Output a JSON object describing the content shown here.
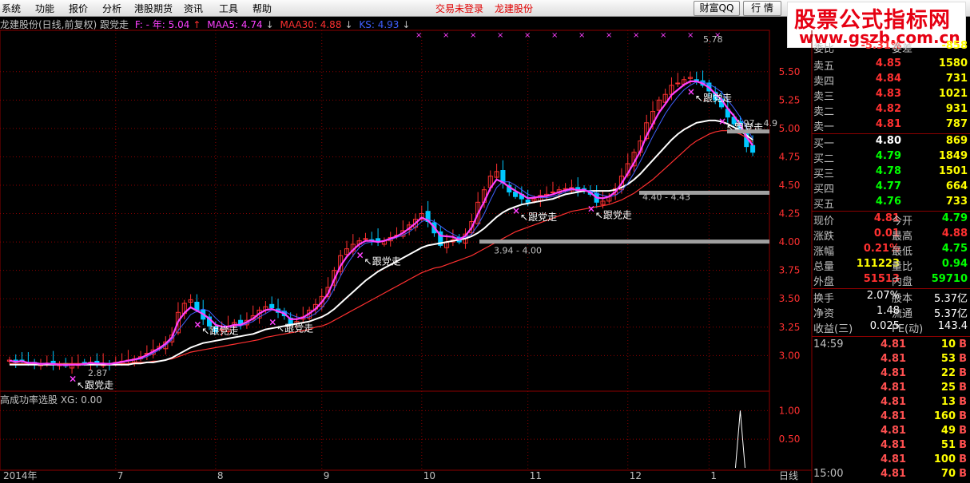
{
  "menu": {
    "items": [
      "系统",
      "功能",
      "报价",
      "分析",
      "港股期货",
      "资讯",
      "工具",
      "帮助"
    ],
    "status": "交易未登录",
    "stock_name": "龙建股份",
    "buttons": [
      "财富QQ",
      "行 情"
    ]
  },
  "watermark": {
    "line1": "股票公式指标网",
    "line2": "www.gszb.com.cn"
  },
  "info": {
    "title": "龙建股份(日线,前复权) 跟党走",
    "f_label": "F: - 年: 5.04",
    "maa5": "MAA5: 4.74",
    "maa30": "MAA30: 4.88",
    "ks": "KS: 4.93",
    "sub_label": "高成功率选股 XG: 0.00"
  },
  "colors": {
    "up": "#ff3030",
    "down": "#00c8ff",
    "maa5": "#ff40ff",
    "maa30": "#ff3030",
    "ks": "#4060ff",
    "white": "#ffffff",
    "grid": "#8b0000"
  },
  "chart_data": {
    "type": "candlestick",
    "x_tick_labels": [
      "2014年",
      "7",
      "8",
      "9",
      "10",
      "11",
      "12",
      "1"
    ],
    "y_ticks": [
      "5.50",
      "5.25",
      "5.00",
      "4.75",
      "4.50",
      "4.25",
      "4.00",
      "3.75",
      "3.50",
      "3.25",
      "3.00"
    ],
    "ylim": [
      2.7,
      5.85
    ],
    "sub_y_ticks": [
      "1.00",
      "0.50"
    ],
    "sub_ylim": [
      0,
      1.2
    ],
    "annotations": [
      "5.78",
      "2.87",
      "3.94 - 4.00",
      "4.40 - 4.43",
      "4.97 - 4.9",
      "跟党走"
    ],
    "closes": [
      2.96,
      2.94,
      2.95,
      2.93,
      2.93,
      2.92,
      2.93,
      2.92,
      2.92,
      2.91,
      2.92,
      2.92,
      2.93,
      2.94,
      2.93,
      2.93,
      2.92,
      2.94,
      2.95,
      2.96,
      2.97,
      2.99,
      3.02,
      3.05,
      3.08,
      3.12,
      3.18,
      3.38,
      3.46,
      3.49,
      3.4,
      3.32,
      3.26,
      3.21,
      3.23,
      3.26,
      3.29,
      3.28,
      3.31,
      3.35,
      3.4,
      3.43,
      3.42,
      3.38,
      3.35,
      3.28,
      3.3,
      3.34,
      3.4,
      3.45,
      3.52,
      3.6,
      3.75,
      3.88,
      3.94,
      3.98,
      4.01,
      4.03,
      4.02,
      4.0,
      4.01,
      4.04,
      4.06,
      4.1,
      4.15,
      4.2,
      4.25,
      4.18,
      4.08,
      3.97,
      4.0,
      4.02,
      4.0,
      4.07,
      4.18,
      4.35,
      4.46,
      4.58,
      4.62,
      4.52,
      4.44,
      4.4,
      4.38,
      4.35,
      4.38,
      4.41,
      4.42,
      4.44,
      4.46,
      4.47,
      4.48,
      4.45,
      4.46,
      4.42,
      4.35,
      4.36,
      4.4,
      4.47,
      4.58,
      4.69,
      4.79,
      4.89,
      5.05,
      5.15,
      5.25,
      5.3,
      5.38,
      5.4,
      5.43,
      5.45,
      5.42,
      5.38,
      5.33,
      5.25,
      5.19,
      5.1,
      5.04,
      4.97,
      4.84,
      4.79
    ],
    "maa5": [
      2.95,
      2.95,
      2.95,
      2.94,
      2.94,
      2.93,
      2.93,
      2.93,
      2.92,
      2.92,
      2.92,
      2.92,
      2.92,
      2.93,
      2.93,
      2.93,
      2.93,
      2.93,
      2.94,
      2.95,
      2.96,
      2.97,
      2.99,
      3.02,
      3.05,
      3.09,
      3.14,
      3.22,
      3.29,
      3.36,
      3.39,
      3.41,
      3.39,
      3.33,
      3.28,
      3.25,
      3.25,
      3.26,
      3.28,
      3.3,
      3.34,
      3.37,
      3.4,
      3.4,
      3.39,
      3.36,
      3.34,
      3.33,
      3.34,
      3.37,
      3.42,
      3.49,
      3.59,
      3.7,
      3.8,
      3.88,
      3.95,
      3.99,
      4.0,
      4.0,
      4.01,
      4.02,
      4.04,
      4.06,
      4.09,
      4.13,
      4.18,
      4.2,
      4.18,
      4.14,
      4.1,
      4.07,
      4.04,
      4.04,
      4.07,
      4.15,
      4.25,
      4.37,
      4.48,
      4.53,
      4.53,
      4.5,
      4.46,
      4.42,
      4.4,
      4.39,
      4.39,
      4.4,
      4.42,
      4.44,
      4.46,
      4.46,
      4.46,
      4.45,
      4.43,
      4.41,
      4.4,
      4.41,
      4.45,
      4.52,
      4.61,
      4.71,
      4.82,
      4.93,
      5.03,
      5.13,
      5.21,
      5.28,
      5.34,
      5.38,
      5.41,
      5.41,
      5.39,
      5.36,
      5.32,
      5.25,
      5.18,
      5.1,
      5.01,
      4.91
    ],
    "maa30": [
      2.93,
      2.93,
      2.93,
      2.93,
      2.93,
      2.93,
      2.93,
      2.93,
      2.93,
      2.93,
      2.93,
      2.93,
      2.93,
      2.93,
      2.93,
      2.93,
      2.93,
      2.93,
      2.93,
      2.93,
      2.94,
      2.94,
      2.94,
      2.95,
      2.95,
      2.96,
      2.97,
      2.99,
      3.01,
      3.03,
      3.04,
      3.05,
      3.06,
      3.07,
      3.08,
      3.09,
      3.1,
      3.11,
      3.12,
      3.13,
      3.14,
      3.16,
      3.17,
      3.18,
      3.19,
      3.2,
      3.21,
      3.22,
      3.23,
      3.25,
      3.26,
      3.28,
      3.31,
      3.34,
      3.37,
      3.4,
      3.43,
      3.46,
      3.49,
      3.52,
      3.55,
      3.58,
      3.61,
      3.64,
      3.67,
      3.7,
      3.73,
      3.75,
      3.77,
      3.78,
      3.8,
      3.82,
      3.84,
      3.86,
      3.88,
      3.91,
      3.94,
      3.97,
      4.0,
      4.03,
      4.06,
      4.09,
      4.11,
      4.13,
      4.15,
      4.17,
      4.19,
      4.21,
      4.23,
      4.25,
      4.27,
      4.28,
      4.29,
      4.3,
      4.31,
      4.32,
      4.33,
      4.35,
      4.37,
      4.4,
      4.43,
      4.47,
      4.51,
      4.55,
      4.6,
      4.65,
      4.7,
      4.75,
      4.8,
      4.85,
      4.89,
      4.92,
      4.95,
      4.97,
      4.98,
      4.98,
      4.97,
      4.95,
      4.92,
      4.88
    ],
    "ks": [
      2.92,
      2.92,
      2.92,
      2.92,
      2.92,
      2.92,
      2.92,
      2.92,
      2.92,
      2.92,
      2.92,
      2.92,
      2.92,
      2.92,
      2.92,
      2.92,
      2.92,
      2.92,
      2.92,
      2.92,
      2.93,
      2.93,
      2.94,
      2.94,
      2.95,
      2.96,
      2.98,
      3.01,
      3.04,
      3.07,
      3.09,
      3.11,
      3.12,
      3.13,
      3.14,
      3.15,
      3.16,
      3.17,
      3.18,
      3.19,
      3.21,
      3.23,
      3.24,
      3.25,
      3.26,
      3.27,
      3.28,
      3.29,
      3.3,
      3.32,
      3.34,
      3.37,
      3.41,
      3.46,
      3.51,
      3.56,
      3.61,
      3.66,
      3.7,
      3.74,
      3.77,
      3.8,
      3.83,
      3.86,
      3.89,
      3.92,
      3.95,
      3.97,
      3.98,
      3.99,
      4.0,
      4.01,
      4.02,
      4.03,
      4.05,
      4.08,
      4.12,
      4.17,
      4.22,
      4.26,
      4.29,
      4.31,
      4.33,
      4.34,
      4.35,
      4.36,
      4.37,
      4.38,
      4.4,
      4.42,
      4.43,
      4.44,
      4.45,
      4.45,
      4.45,
      4.45,
      4.45,
      4.46,
      4.48,
      4.51,
      4.55,
      4.6,
      4.66,
      4.72,
      4.78,
      4.84,
      4.9,
      4.95,
      4.99,
      5.02,
      5.05,
      5.06,
      5.07,
      5.07,
      5.06,
      5.04,
      5.01,
      4.98,
      4.94,
      4.9
    ],
    "xg_signals": [
      117
    ],
    "signal_bars": [
      10,
      30,
      42,
      56,
      81,
      93,
      109,
      114
    ]
  },
  "quote": {
    "header": {
      "label": "委比",
      "value": "-5.31%",
      "label2": "委差",
      "value2": "-858"
    },
    "asks": [
      {
        "label": "卖五",
        "price": "4.85",
        "vol": "1580"
      },
      {
        "label": "卖四",
        "price": "4.84",
        "vol": "731"
      },
      {
        "label": "卖三",
        "price": "4.83",
        "vol": "1021"
      },
      {
        "label": "卖二",
        "price": "4.82",
        "vol": "931"
      },
      {
        "label": "卖一",
        "price": "4.81",
        "vol": "787"
      }
    ],
    "bids": [
      {
        "label": "买一",
        "price": "4.80",
        "vol": "869"
      },
      {
        "label": "买二",
        "price": "4.79",
        "vol": "1849"
      },
      {
        "label": "买三",
        "price": "4.78",
        "vol": "1501"
      },
      {
        "label": "买四",
        "price": "4.77",
        "vol": "664"
      },
      {
        "label": "买五",
        "price": "4.76",
        "vol": "733"
      }
    ],
    "stats": [
      {
        "l1": "现价",
        "v1": "4.81",
        "c1": "#ff3030",
        "l2": "今开",
        "v2": "4.79",
        "c2": "#00ff00"
      },
      {
        "l1": "涨跌",
        "v1": "0.01",
        "c1": "#ff3030",
        "l2": "最高",
        "v2": "4.88",
        "c2": "#ff3030"
      },
      {
        "l1": "涨幅",
        "v1": "0.21%",
        "c1": "#ff3030",
        "l2": "最低",
        "v2": "4.75",
        "c2": "#00ff00"
      },
      {
        "l1": "总量",
        "v1": "111223",
        "c1": "#ffff00",
        "l2": "量比",
        "v2": "0.94",
        "c2": "#00ff00"
      },
      {
        "l1": "外盘",
        "v1": "51513",
        "c1": "#ff3030",
        "l2": "内盘",
        "v2": "59710",
        "c2": "#00ff00"
      }
    ],
    "stats2": [
      {
        "l1": "换手",
        "v1": "2.07%",
        "c1": "#ffffff",
        "l2": "股本",
        "v2": "5.37亿",
        "c2": "#ffffff"
      },
      {
        "l1": "净资",
        "v1": "1.48",
        "c1": "#ffffff",
        "l2": "流通",
        "v2": "5.37亿",
        "c2": "#ffffff"
      },
      {
        "l1": "收益(三)",
        "v1": "0.025",
        "c1": "#ffffff",
        "l2": "PE(动)",
        "v2": "143.4",
        "c2": "#ffffff"
      }
    ],
    "ticks": [
      {
        "time": "14:59",
        "price": "4.81",
        "vol": "10",
        "side": "B"
      },
      {
        "time": "",
        "price": "4.81",
        "vol": "53",
        "side": "B"
      },
      {
        "time": "",
        "price": "4.81",
        "vol": "22",
        "side": "B"
      },
      {
        "time": "",
        "price": "4.81",
        "vol": "25",
        "side": "B"
      },
      {
        "time": "",
        "price": "4.81",
        "vol": "13",
        "side": "B"
      },
      {
        "time": "",
        "price": "4.81",
        "vol": "160",
        "side": "B"
      },
      {
        "time": "",
        "price": "4.81",
        "vol": "49",
        "side": "B"
      },
      {
        "time": "",
        "price": "4.81",
        "vol": "51",
        "side": "B"
      },
      {
        "time": "",
        "price": "4.81",
        "vol": "100",
        "side": "B"
      },
      {
        "time": "15:00",
        "price": "4.81",
        "vol": "70",
        "side": "B"
      }
    ],
    "period": "日线"
  }
}
